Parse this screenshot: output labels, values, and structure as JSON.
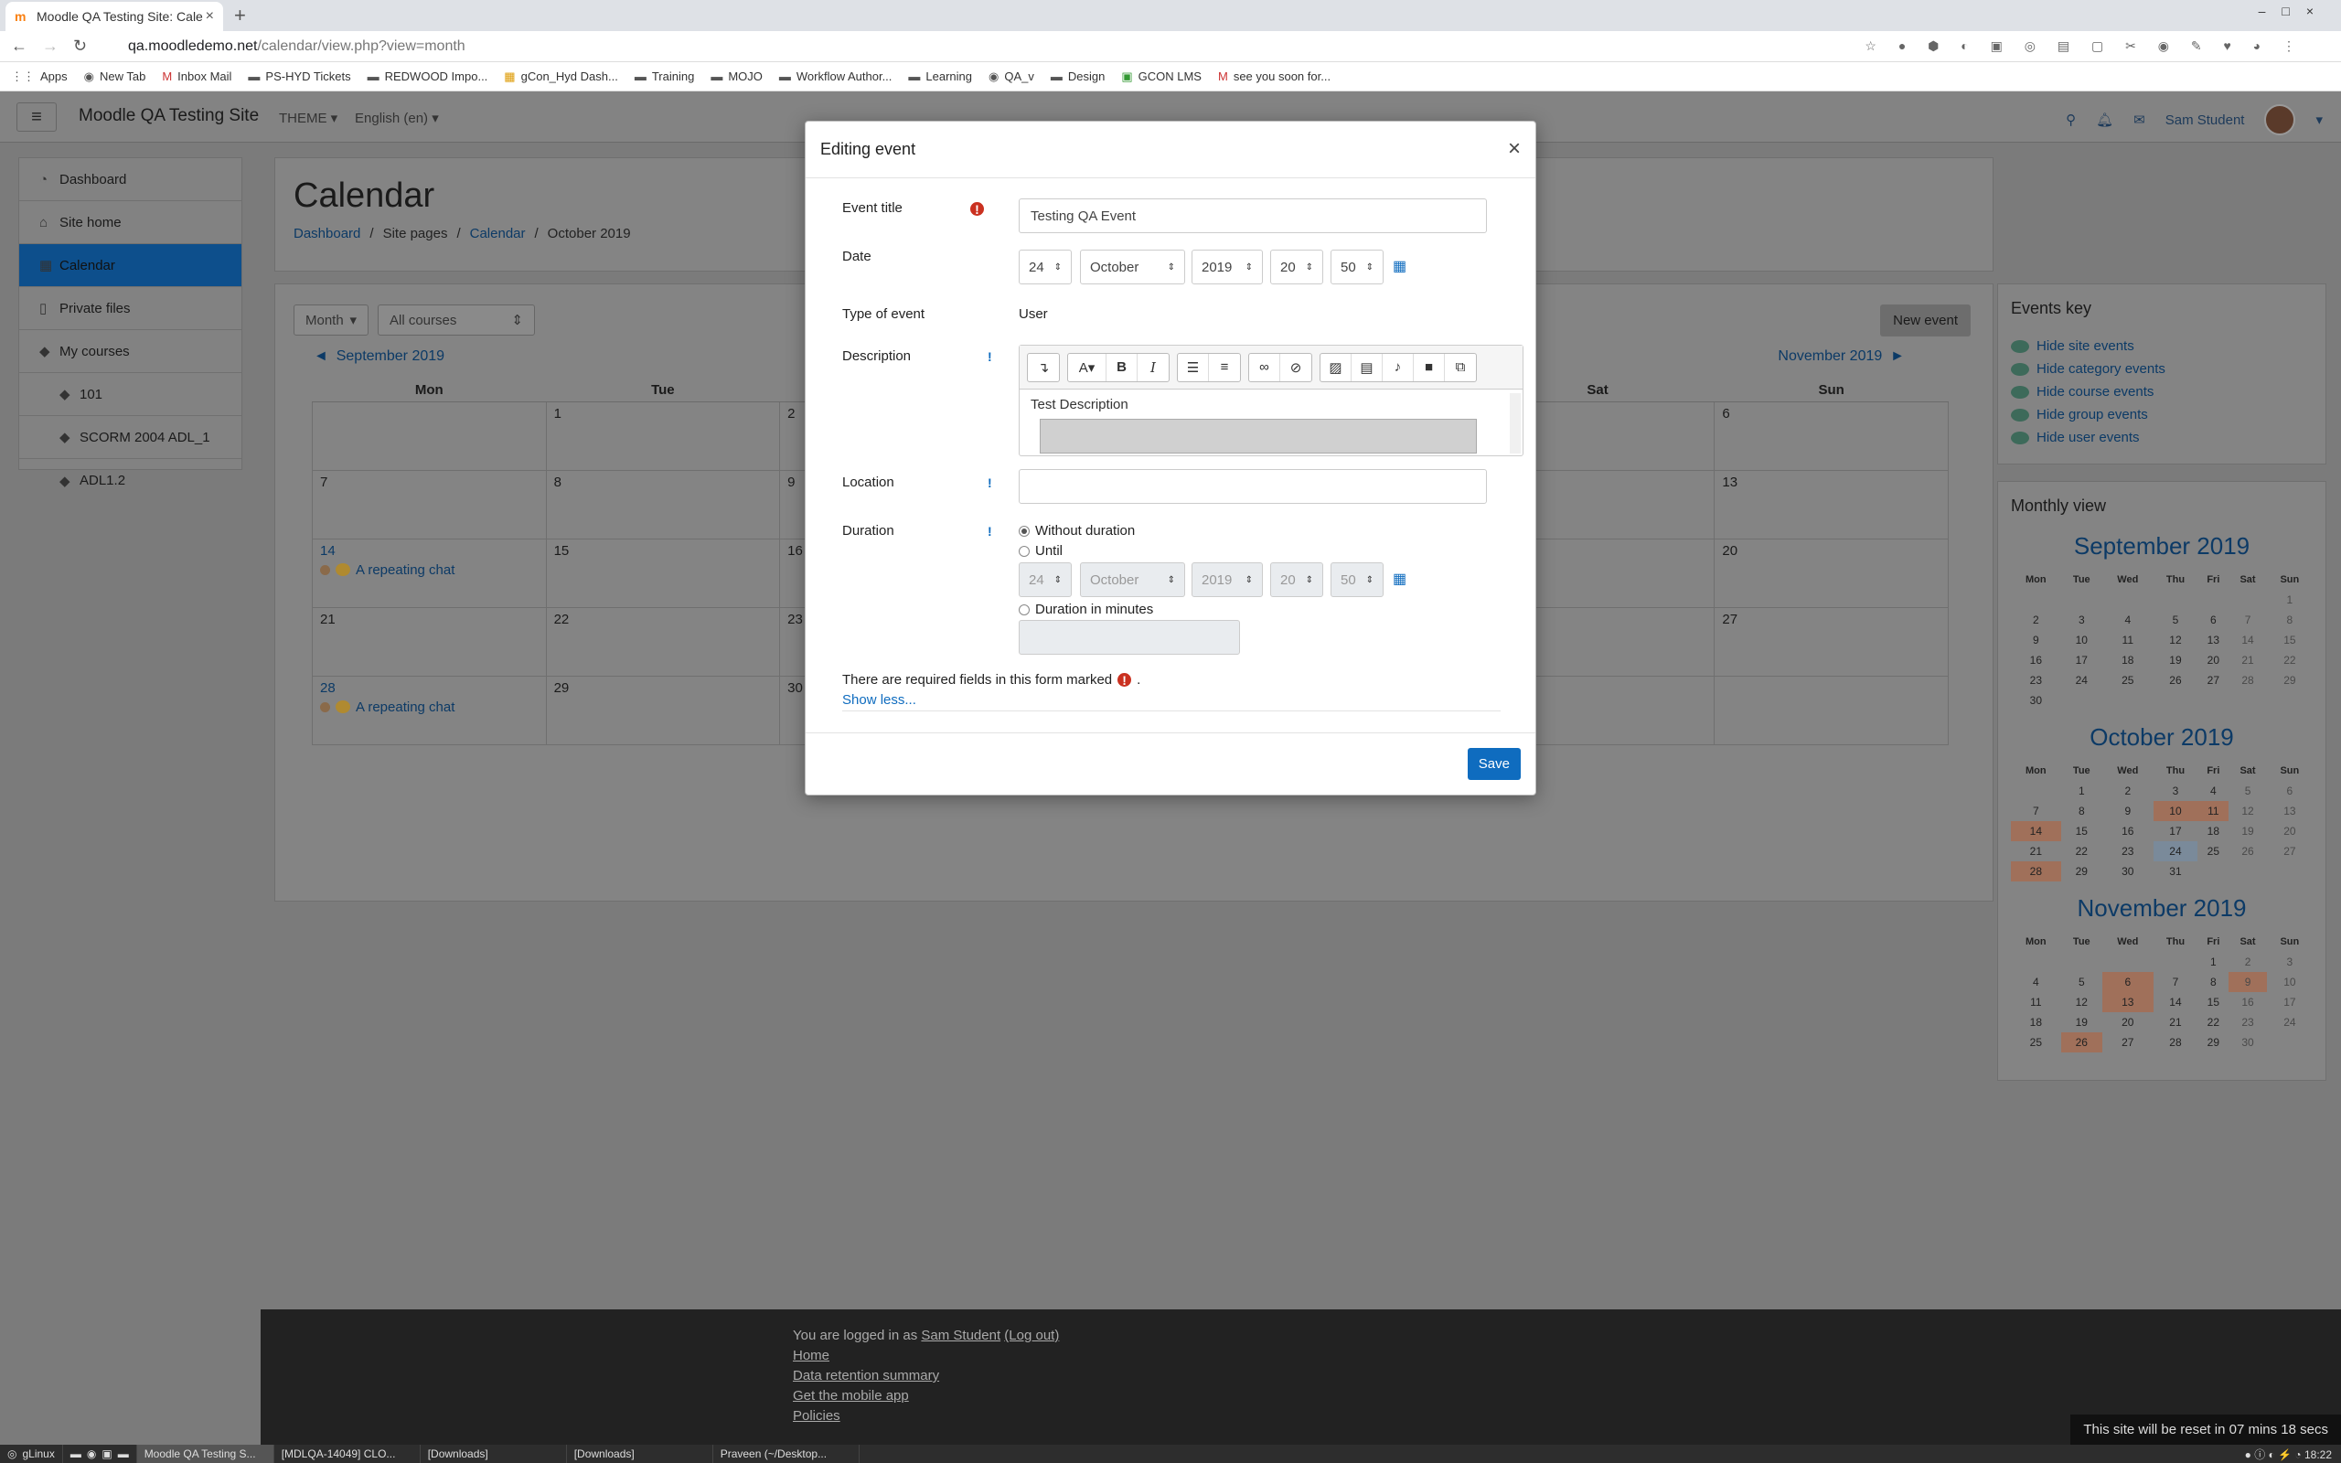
{
  "browser": {
    "tab_title": "Moodle QA Testing Site: Cale",
    "url_host": "qa.moodledemo.net",
    "url_path": "/calendar/view.php?view=month",
    "bookmarks": [
      "Apps",
      "New Tab",
      "Inbox Mail",
      "PS-HYD Tickets",
      "REDWOOD Impo...",
      "gCon_Hyd Dash...",
      "Training",
      "MOJO",
      "Workflow Author...",
      "Learning",
      "QA_v",
      "Design",
      "GCON LMS",
      "see you soon for..."
    ]
  },
  "navbar": {
    "site_name": "Moodle QA Testing Site",
    "theme": "THEME",
    "language": "English (en)",
    "user": "Sam Student"
  },
  "drawer": {
    "items": [
      {
        "label": "Dashboard",
        "icon": "dashboard-icon"
      },
      {
        "label": "Site home",
        "icon": "home-icon"
      },
      {
        "label": "Calendar",
        "icon": "calendar-icon"
      },
      {
        "label": "Private files",
        "icon": "file-icon"
      },
      {
        "label": "My courses",
        "icon": "graduation-cap-icon"
      },
      {
        "label": "101",
        "icon": "graduation-cap-icon"
      },
      {
        "label": "SCORM 2004 ADL_1",
        "icon": "graduation-cap-icon"
      },
      {
        "label": "ADL1.2",
        "icon": "graduation-cap-icon"
      }
    ]
  },
  "header": {
    "title": "Calendar",
    "breadcrumb": [
      "Dashboard",
      "Site pages",
      "Calendar",
      "October 2019"
    ]
  },
  "calendar": {
    "view_select": "Month",
    "course_select": "All courses",
    "new_event": "New event",
    "prev_month": "September 2019",
    "next_month": "November 2019",
    "weekdays": [
      "Mon",
      "Tue",
      "Wed",
      "Thu",
      "Fri",
      "Sat",
      "Sun"
    ],
    "rows": [
      [
        "",
        "1",
        "2",
        "",
        "",
        "",
        "6"
      ],
      [
        "7",
        "8",
        "9",
        "",
        "",
        "",
        "13"
      ],
      [
        "14",
        "15",
        "16",
        "",
        "",
        "",
        "20"
      ],
      [
        "21",
        "22",
        "23",
        "",
        "",
        "",
        "27"
      ],
      [
        "28",
        "29",
        "30",
        "",
        "",
        "",
        ""
      ]
    ],
    "event_label": "A repeating chat"
  },
  "events_key": {
    "title": "Events key",
    "items": [
      "Hide site events",
      "Hide category events",
      "Hide course events",
      "Hide group events",
      "Hide user events"
    ]
  },
  "monthly_view": {
    "title": "Monthly view",
    "weekdays": [
      "Mon",
      "Tue",
      "Wed",
      "Thu",
      "Fri",
      "Sat",
      "Sun"
    ],
    "months": [
      {
        "name": "September 2019",
        "weeks": [
          [
            "",
            "",
            "",
            "",
            "",
            "",
            "1"
          ],
          [
            "2",
            "3",
            "4",
            "5",
            "6",
            "7",
            "8"
          ],
          [
            "9",
            "10",
            "11",
            "12",
            "13",
            "14",
            "15"
          ],
          [
            "16",
            "17",
            "18",
            "19",
            "20",
            "21",
            "22"
          ],
          [
            "23",
            "24",
            "25",
            "26",
            "27",
            "28",
            "29"
          ],
          [
            "30",
            "",
            "",
            "",
            "",
            "",
            ""
          ]
        ]
      },
      {
        "name": "October 2019",
        "weeks": [
          [
            "",
            "1",
            "2",
            "3",
            "4",
            "5",
            "6"
          ],
          [
            "7",
            "8",
            "9",
            "10",
            "11",
            "12",
            "13"
          ],
          [
            "14",
            "15",
            "16",
            "17",
            "18",
            "19",
            "20"
          ],
          [
            "21",
            "22",
            "23",
            "24",
            "25",
            "26",
            "27"
          ],
          [
            "28",
            "29",
            "30",
            "31",
            "",
            "",
            ""
          ]
        ]
      },
      {
        "name": "November 2019",
        "weeks": [
          [
            "",
            "",
            "",
            "",
            "1",
            "2",
            "3"
          ],
          [
            "4",
            "5",
            "6",
            "7",
            "8",
            "9",
            "10"
          ],
          [
            "11",
            "12",
            "13",
            "14",
            "15",
            "16",
            "17"
          ],
          [
            "18",
            "19",
            "20",
            "21",
            "22",
            "23",
            "24"
          ],
          [
            "25",
            "26",
            "27",
            "28",
            "29",
            "30",
            ""
          ]
        ]
      }
    ]
  },
  "modal": {
    "title": "Editing event",
    "close": "×",
    "event_title_label": "Event title",
    "event_title_value": "Testing QA Event",
    "date_label": "Date",
    "date": {
      "day": "24",
      "month": "October",
      "year": "2019",
      "hour": "20",
      "minute": "50"
    },
    "type_label": "Type of event",
    "type_value": "User",
    "description_label": "Description",
    "description_value": "Test Description",
    "location_label": "Location",
    "duration_label": "Duration",
    "duration_opt1": "Without duration",
    "duration_opt2": "Until",
    "duration_opt3": "Duration in minutes",
    "until": {
      "day": "24",
      "month": "October",
      "year": "2019",
      "hour": "20",
      "minute": "50"
    },
    "required_note": "There are required fields in this form marked",
    "show_less": "Show less...",
    "save": "Save"
  },
  "footer": {
    "logged_in_prefix": "You are logged in as",
    "user": "Sam Student",
    "logout": "(Log out)",
    "links": [
      "Home",
      "Data retention summary",
      "Get the mobile app",
      "Policies"
    ],
    "reset": "This site will be reset in 07 mins 18 secs"
  },
  "taskbar": {
    "start": "gLinux",
    "windows": [
      "Moodle QA Testing S...",
      "[MDLQA-14049] CLO...",
      "[Downloads]",
      "[Downloads]",
      "Praveen (~/Desktop..."
    ],
    "time": "18:22"
  }
}
